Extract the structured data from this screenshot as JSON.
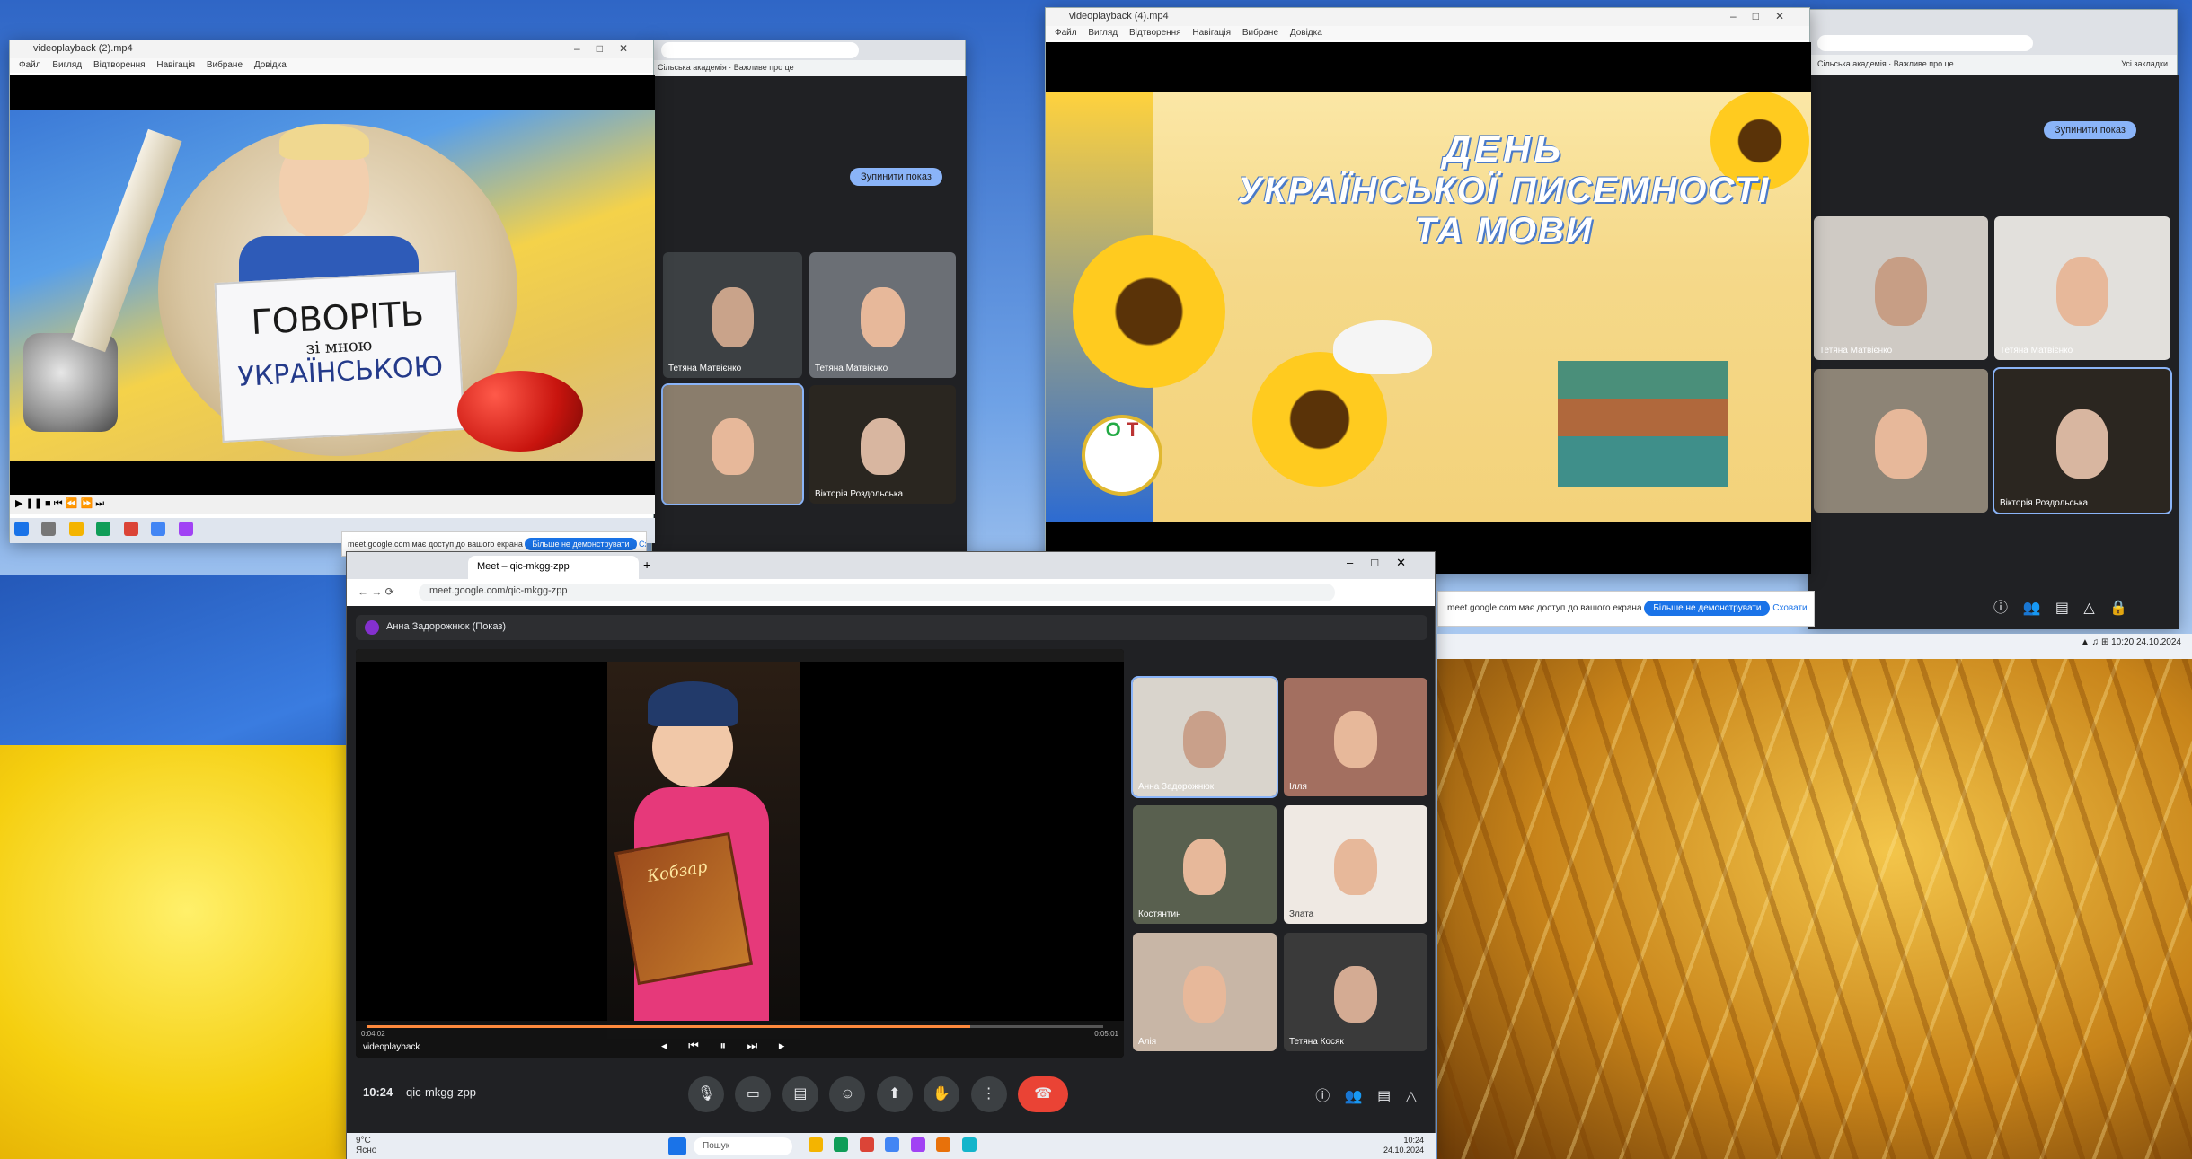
{
  "colors": {
    "meet_bg": "#202124",
    "accent": "#8ab4f8",
    "hangup": "#ea4335"
  },
  "left_player": {
    "title": "videoplayback (2).mp4",
    "menu": [
      "Файл",
      "Вигляд",
      "Відтворення",
      "Навігація",
      "Вибране",
      "Довідка"
    ],
    "sign_line1": "ГОВОРІТЬ",
    "sign_line2": "зі мною",
    "sign_line3": "УКРАЇНСЬКОЮ"
  },
  "left_meet": {
    "tabs": [
      "Сільська академія",
      "Важливе про це"
    ],
    "stop_share": "Зупинити показ",
    "tiles": [
      "Тетяна Матвієнко",
      "Тетяна Матвієнко",
      "",
      "Вікторія Роздольська"
    ],
    "notice_text": "meet.google.com має доступ до вашого екрана",
    "notice_button": "Більше не демонструвати",
    "notice_hide": "Сховати"
  },
  "right_player": {
    "title": "videoplayback (4).mp4",
    "menu": [
      "Файл",
      "Вигляд",
      "Відтворення",
      "Навігація",
      "Вибране",
      "Довідка"
    ],
    "heading_line1": "ДЕНЬ",
    "heading_line2": "УКРАЇНСЬКОЇ ПИСЕМНОСТІ",
    "heading_line3": "ТА МОВИ",
    "logo_letters": [
      "О",
      "Т"
    ]
  },
  "right_meet": {
    "tabs": [
      "Сільська академія",
      "Важливе про це"
    ],
    "bookmarks": "Усі закладки",
    "stop_share": "Зупинити показ",
    "tiles": [
      "Тетяна Матвієнко",
      "Тетяна Матвієнко",
      "",
      "Вікторія Роздольська"
    ],
    "notice_text": "meet.google.com має доступ до вашого екрана",
    "notice_button": "Більше не демонструвати",
    "notice_hide": "Сховати",
    "clock_time": "10:20",
    "clock_date": "24.10.2024"
  },
  "main_meet": {
    "tab_title": "Meet – qic-mkgg-zpp",
    "url": "meet.google.com/qic-mkgg-zpp",
    "presenter_label": "Анна Задорожнюк (Показ)",
    "inner_player": "videoplayback",
    "time_elapsed": "0:04:02",
    "time_total": "0:05:01",
    "book_title": "Кобзар",
    "meeting_time": "10:24",
    "meeting_code": "qic-mkgg-zpp",
    "tiles": [
      "Анна Задорожнюк",
      "Ілля",
      "Костянтин",
      "Злата",
      "Алія",
      "Тетяна Косяк"
    ],
    "progress": 0.82
  },
  "bottom_taskbar": {
    "weather": "9°C",
    "weather_desc": "Ясно",
    "search": "Пошук",
    "time": "10:24",
    "date": "24.10.2024"
  }
}
